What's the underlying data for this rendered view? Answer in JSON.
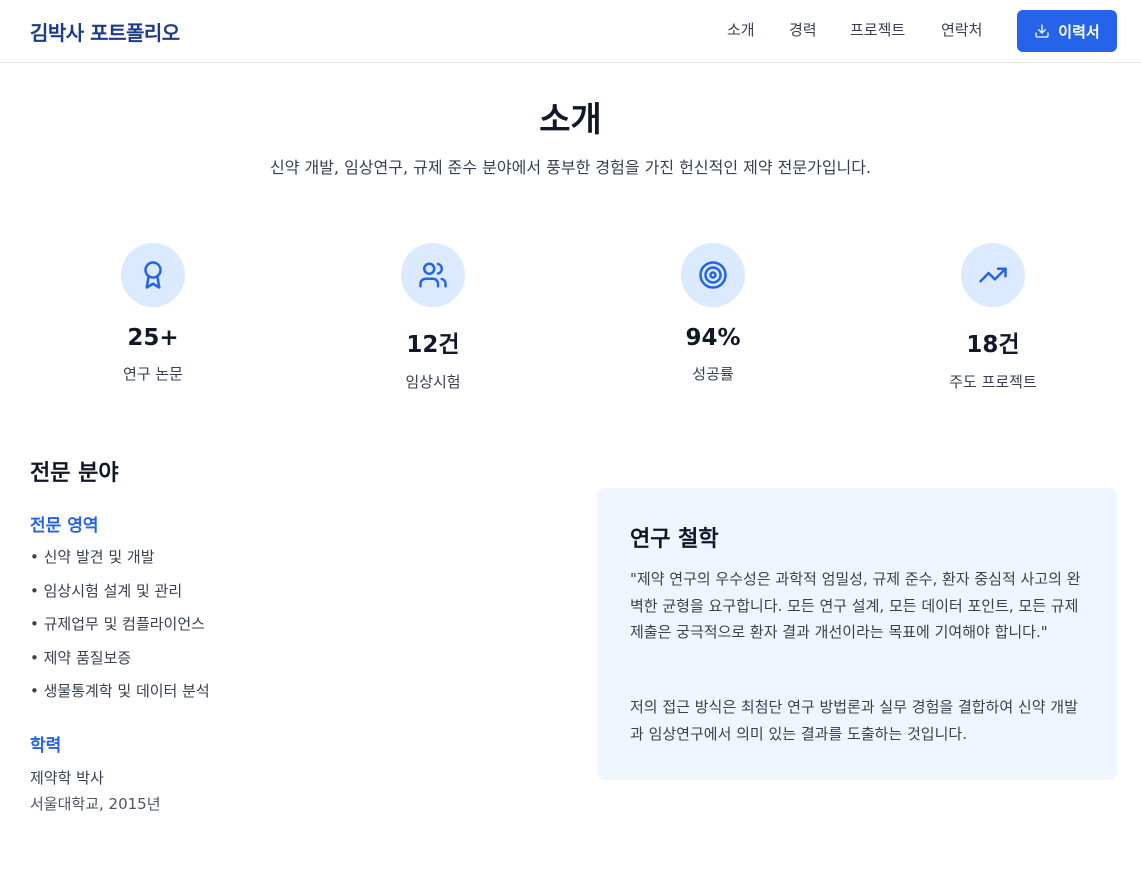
{
  "header": {
    "brand": "김박사 포트폴리오",
    "nav": [
      "소개",
      "경력",
      "프로젝트",
      "연락처"
    ],
    "resume_label": "이력서"
  },
  "intro": {
    "title": "소개",
    "subtitle": "신약 개발, 임상연구, 규제 준수 분야에서 풍부한 경험을 가진 헌신적인 제약 전문가입니다."
  },
  "stats": [
    {
      "icon": "award-icon",
      "value": "25+",
      "label": "연구 논문"
    },
    {
      "icon": "users-icon",
      "value": "12건",
      "label": "임상시험"
    },
    {
      "icon": "target-icon",
      "value": "94%",
      "label": "성공률"
    },
    {
      "icon": "trending-up-icon",
      "value": "18건",
      "label": "주도 프로젝트"
    }
  ],
  "expertise": {
    "title": "전문 분야",
    "areas_heading": "전문 영역",
    "areas": [
      "• 신약 발견 및 개발",
      "• 임상시험 설계 및 관리",
      "• 규제업무 및 컴플라이언스",
      "• 제약 품질보증",
      "• 생물통계학 및 데이터 분석"
    ],
    "education_heading": "학력",
    "degree": "제약학 박사",
    "school": "서울대학교, 2015년"
  },
  "philosophy": {
    "title": "연구 철학",
    "paragraph1": "\"제약 연구의 우수성은 과학적 엄밀성, 규제 준수, 환자 중심적 사고의 완벽한 균형을 요구합니다. 모든 연구 설계, 모든 데이터 포인트, 모든 규제 제출은 궁극적으로 환자 결과 개선이라는 목표에 기여해야 합니다.\"",
    "paragraph2": "저의 접근 방식은 최첨단 연구 방법론과 실무 경험을 결합하여 신약 개발과 임상연구에서 의미 있는 결과를 도출하는 것입니다."
  },
  "colors": {
    "accent": "#2563eb",
    "brand": "#1e3a8a",
    "icon_bg": "#dbeafe",
    "card_bg": "#eff6ff"
  }
}
